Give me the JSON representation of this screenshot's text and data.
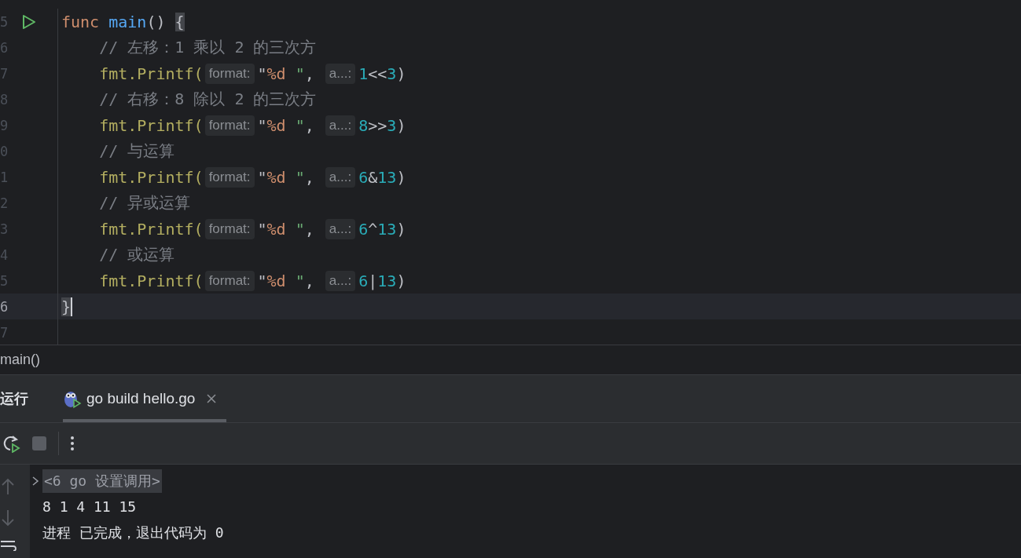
{
  "editor": {
    "lines": [
      {
        "number": "5",
        "run_marker": true,
        "current": false,
        "tokens": [
          {
            "t": "func ",
            "kind": "keyword"
          },
          {
            "t": "main",
            "kind": "function"
          },
          {
            "t": "() ",
            "kind": "plain"
          },
          {
            "t": "{",
            "kind": "brace-match"
          }
        ]
      },
      {
        "number": "6",
        "run_marker": false,
        "current": false,
        "tokens": [
          {
            "t": "    // 左移：1 乘以 2 的三次方",
            "kind": "comment"
          }
        ]
      },
      {
        "number": "7",
        "run_marker": false,
        "current": false,
        "tokens": [
          {
            "t": "    fmt.Printf(",
            "kind": "call"
          },
          {
            "t": "format:",
            "kind": "hint"
          },
          {
            "t": "\"",
            "kind": "plain"
          },
          {
            "t": "%d",
            "kind": "format"
          },
          {
            "t": " \"",
            "kind": "string"
          },
          {
            "t": ", ",
            "kind": "plain"
          },
          {
            "t": "a...:",
            "kind": "hint"
          },
          {
            "t": "1",
            "kind": "number"
          },
          {
            "t": "<<",
            "kind": "plain"
          },
          {
            "t": "3",
            "kind": "number"
          },
          {
            "t": ")",
            "kind": "plain"
          }
        ]
      },
      {
        "number": "8",
        "run_marker": false,
        "current": false,
        "tokens": [
          {
            "t": "    // 右移：8 除以 2 的三次方",
            "kind": "comment"
          }
        ]
      },
      {
        "number": "9",
        "run_marker": false,
        "current": false,
        "tokens": [
          {
            "t": "    fmt.Printf(",
            "kind": "call"
          },
          {
            "t": "format:",
            "kind": "hint"
          },
          {
            "t": "\"",
            "kind": "plain"
          },
          {
            "t": "%d",
            "kind": "format"
          },
          {
            "t": " \"",
            "kind": "string"
          },
          {
            "t": ", ",
            "kind": "plain"
          },
          {
            "t": "a...:",
            "kind": "hint"
          },
          {
            "t": "8",
            "kind": "number"
          },
          {
            "t": ">>",
            "kind": "plain"
          },
          {
            "t": "3",
            "kind": "number"
          },
          {
            "t": ")",
            "kind": "plain"
          }
        ]
      },
      {
        "number": "0",
        "run_marker": false,
        "current": false,
        "tokens": [
          {
            "t": "    // 与运算",
            "kind": "comment"
          }
        ]
      },
      {
        "number": "1",
        "run_marker": false,
        "current": false,
        "tokens": [
          {
            "t": "    fmt.Printf(",
            "kind": "call"
          },
          {
            "t": "format:",
            "kind": "hint"
          },
          {
            "t": "\"",
            "kind": "plain"
          },
          {
            "t": "%d",
            "kind": "format"
          },
          {
            "t": " \"",
            "kind": "string"
          },
          {
            "t": ", ",
            "kind": "plain"
          },
          {
            "t": "a...:",
            "kind": "hint"
          },
          {
            "t": "6",
            "kind": "number"
          },
          {
            "t": "&",
            "kind": "plain"
          },
          {
            "t": "13",
            "kind": "number"
          },
          {
            "t": ")",
            "kind": "plain"
          }
        ]
      },
      {
        "number": "2",
        "run_marker": false,
        "current": false,
        "tokens": [
          {
            "t": "    // 异或运算",
            "kind": "comment"
          }
        ]
      },
      {
        "number": "3",
        "run_marker": false,
        "current": false,
        "tokens": [
          {
            "t": "    fmt.Printf(",
            "kind": "call"
          },
          {
            "t": "format:",
            "kind": "hint"
          },
          {
            "t": "\"",
            "kind": "plain"
          },
          {
            "t": "%d",
            "kind": "format"
          },
          {
            "t": " \"",
            "kind": "string"
          },
          {
            "t": ", ",
            "kind": "plain"
          },
          {
            "t": "a...:",
            "kind": "hint"
          },
          {
            "t": "6",
            "kind": "number"
          },
          {
            "t": "^",
            "kind": "plain"
          },
          {
            "t": "13",
            "kind": "number"
          },
          {
            "t": ")",
            "kind": "plain"
          }
        ]
      },
      {
        "number": "4",
        "run_marker": false,
        "current": false,
        "tokens": [
          {
            "t": "    // 或运算",
            "kind": "comment"
          }
        ]
      },
      {
        "number": "5",
        "run_marker": false,
        "current": false,
        "tokens": [
          {
            "t": "    fmt.Printf(",
            "kind": "call"
          },
          {
            "t": "format:",
            "kind": "hint"
          },
          {
            "t": "\"",
            "kind": "plain"
          },
          {
            "t": "%d",
            "kind": "format"
          },
          {
            "t": " \"",
            "kind": "string"
          },
          {
            "t": ", ",
            "kind": "plain"
          },
          {
            "t": "a...:",
            "kind": "hint"
          },
          {
            "t": "6",
            "kind": "number"
          },
          {
            "t": "|",
            "kind": "plain"
          },
          {
            "t": "13",
            "kind": "number"
          },
          {
            "t": ")",
            "kind": "plain"
          }
        ]
      },
      {
        "number": "6",
        "run_marker": false,
        "current": true,
        "tokens": [
          {
            "t": "}",
            "kind": "brace-match"
          }
        ]
      },
      {
        "number": "7",
        "run_marker": false,
        "current": false
      }
    ]
  },
  "breadcrumb": "main()",
  "run_panel": {
    "title": "运行",
    "tabs": [
      {
        "label": "go build hello.go",
        "selected": true
      }
    ],
    "console": {
      "lines": [
        {
          "kind": "command",
          "text": "<6 go 设置调用>"
        },
        {
          "kind": "output",
          "text": "8 1 4 11 15"
        },
        {
          "kind": "status",
          "text": "进程 已完成，退出代码为 0"
        }
      ]
    }
  }
}
